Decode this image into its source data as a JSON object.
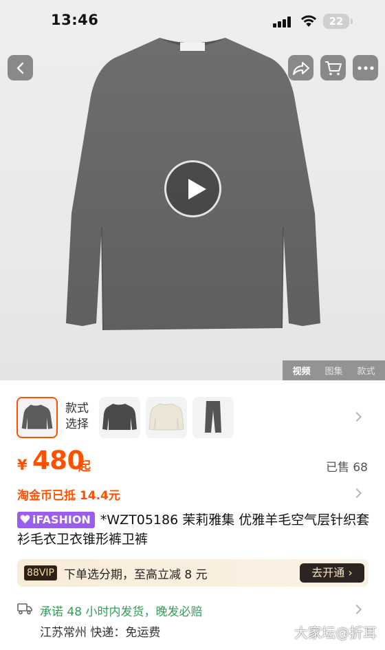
{
  "status_bar": {
    "time": "13:46",
    "battery_level": "22",
    "signal": "signal-icon",
    "wifi": "wifi-icon"
  },
  "header": {
    "back": "back-icon",
    "share": "share-icon",
    "cart": "cart-icon",
    "more": "more-icon"
  },
  "media": {
    "play": "play-icon",
    "tabs": [
      {
        "label": "视频",
        "active": true
      },
      {
        "label": "图集",
        "active": false
      },
      {
        "label": "款式",
        "active": false
      }
    ]
  },
  "variants": {
    "label_line1": "款式",
    "label_line2": "选择",
    "thumbs": [
      "grey-sweater",
      "dark-grey-sweater",
      "cream-sweater",
      "grey-pants"
    ],
    "selected_index": 0
  },
  "price": {
    "currency": "¥",
    "value": "480",
    "suffix": "起",
    "sold": "已售 68"
  },
  "coin": {
    "text": "淘金币已抵 14.4元"
  },
  "title": {
    "brand_tag": "iFASHION",
    "text": "*WZT05186 茉莉雅集 优雅羊毛空气层针织套衫毛衣卫衣锥形裤卫裤"
  },
  "vip": {
    "tag": "88VIP",
    "text": "下单选分期，至高立减 8 元",
    "button": "去开通 ›"
  },
  "shipping": {
    "promise": "承诺 48 小时内发货，晚发必赔",
    "detail": "江苏常州  快递：免运费"
  },
  "watermark": "大家坛@折耳",
  "colors": {
    "accent": "#ff5000",
    "green": "#2f9e56",
    "brand_purple": "#9b5cf0"
  }
}
